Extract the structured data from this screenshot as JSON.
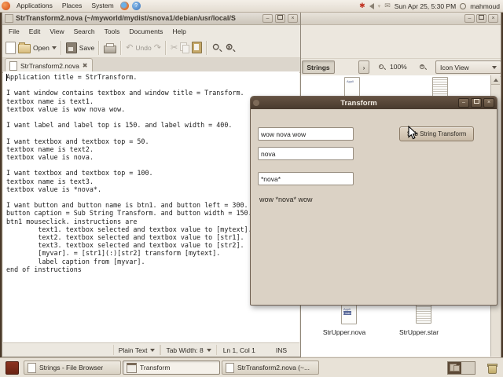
{
  "panel": {
    "menus": {
      "applications": "Applications",
      "places": "Places",
      "system": "System"
    },
    "clock": "Sun Apr 25, 5:30 PM",
    "user": "mahmoud"
  },
  "icons": {
    "minimize": "–",
    "close": "×",
    "scissors": "✂",
    "undo_arrow": "↶",
    "redo_arrow": "↷",
    "mail": "✉",
    "updates": "✱",
    "help": "?"
  },
  "taskbar": {
    "buttons": [
      {
        "label": "Strings - File Browser"
      },
      {
        "label": "Transform"
      },
      {
        "label": "StrTransform2.nova (~..."
      }
    ]
  },
  "gedit": {
    "title": "StrTransform2.nova (~/myworld/mydist/snova1/debian/usr/local/S",
    "menus": [
      "File",
      "Edit",
      "View",
      "Search",
      "Tools",
      "Documents",
      "Help"
    ],
    "toolbar": {
      "open": "Open",
      "save": "Save",
      "undo": "Undo"
    },
    "tab_label": "StrTransform2.nova",
    "editor_text": "Application title = StrTransform.\n\nI want window contains textbox and window title = Transform.\ntextbox name is text1.\ntextbox value is wow nova wow.\n\nI want label and label top is 150. and label width = 400.\n\nI want textbox and textbox top = 50.\ntextbox name is text2.\ntextbox value is nova.\n\nI want textbox and textbox top = 100.\ntextbox name is text3.\ntextbox value is *nova*.\n\nI want button and button name is btn1. and button left = 300.\nbutton caption = Sub String Transform. and button width = 150.\nbtn1 mouseclick. instructions are\n\ttext1. textbox selected and textbox value to [mytext].\n\ttext2. textbox selected and textbox value to [str1].\n\ttext3. textbox selected and textbox value to [str2].\n\t[myvar]. = [str1](:)[str2] transform [mytext].\n\tlabel caption from [myvar].\nend of instructions",
    "status": {
      "language": "Plain Text",
      "tab_width": "Tab Width: 8",
      "cursor": "Ln 1, Col 1",
      "mode": "INS"
    }
  },
  "filebrowser": {
    "location": "Strings",
    "zoom": "100%",
    "view_mode": "Icon View",
    "preview_line1": "Appli",
    "preview_line2": "I wan",
    "files": [
      {
        "name": "StrUpper.nova"
      },
      {
        "name": "StrUpper.star"
      }
    ]
  },
  "dialog": {
    "title": "Transform",
    "field1": "wow nova wow",
    "field2": "nova",
    "field3": "*nova*",
    "button": "Sub String Transform",
    "result": "wow *nova* wow"
  }
}
